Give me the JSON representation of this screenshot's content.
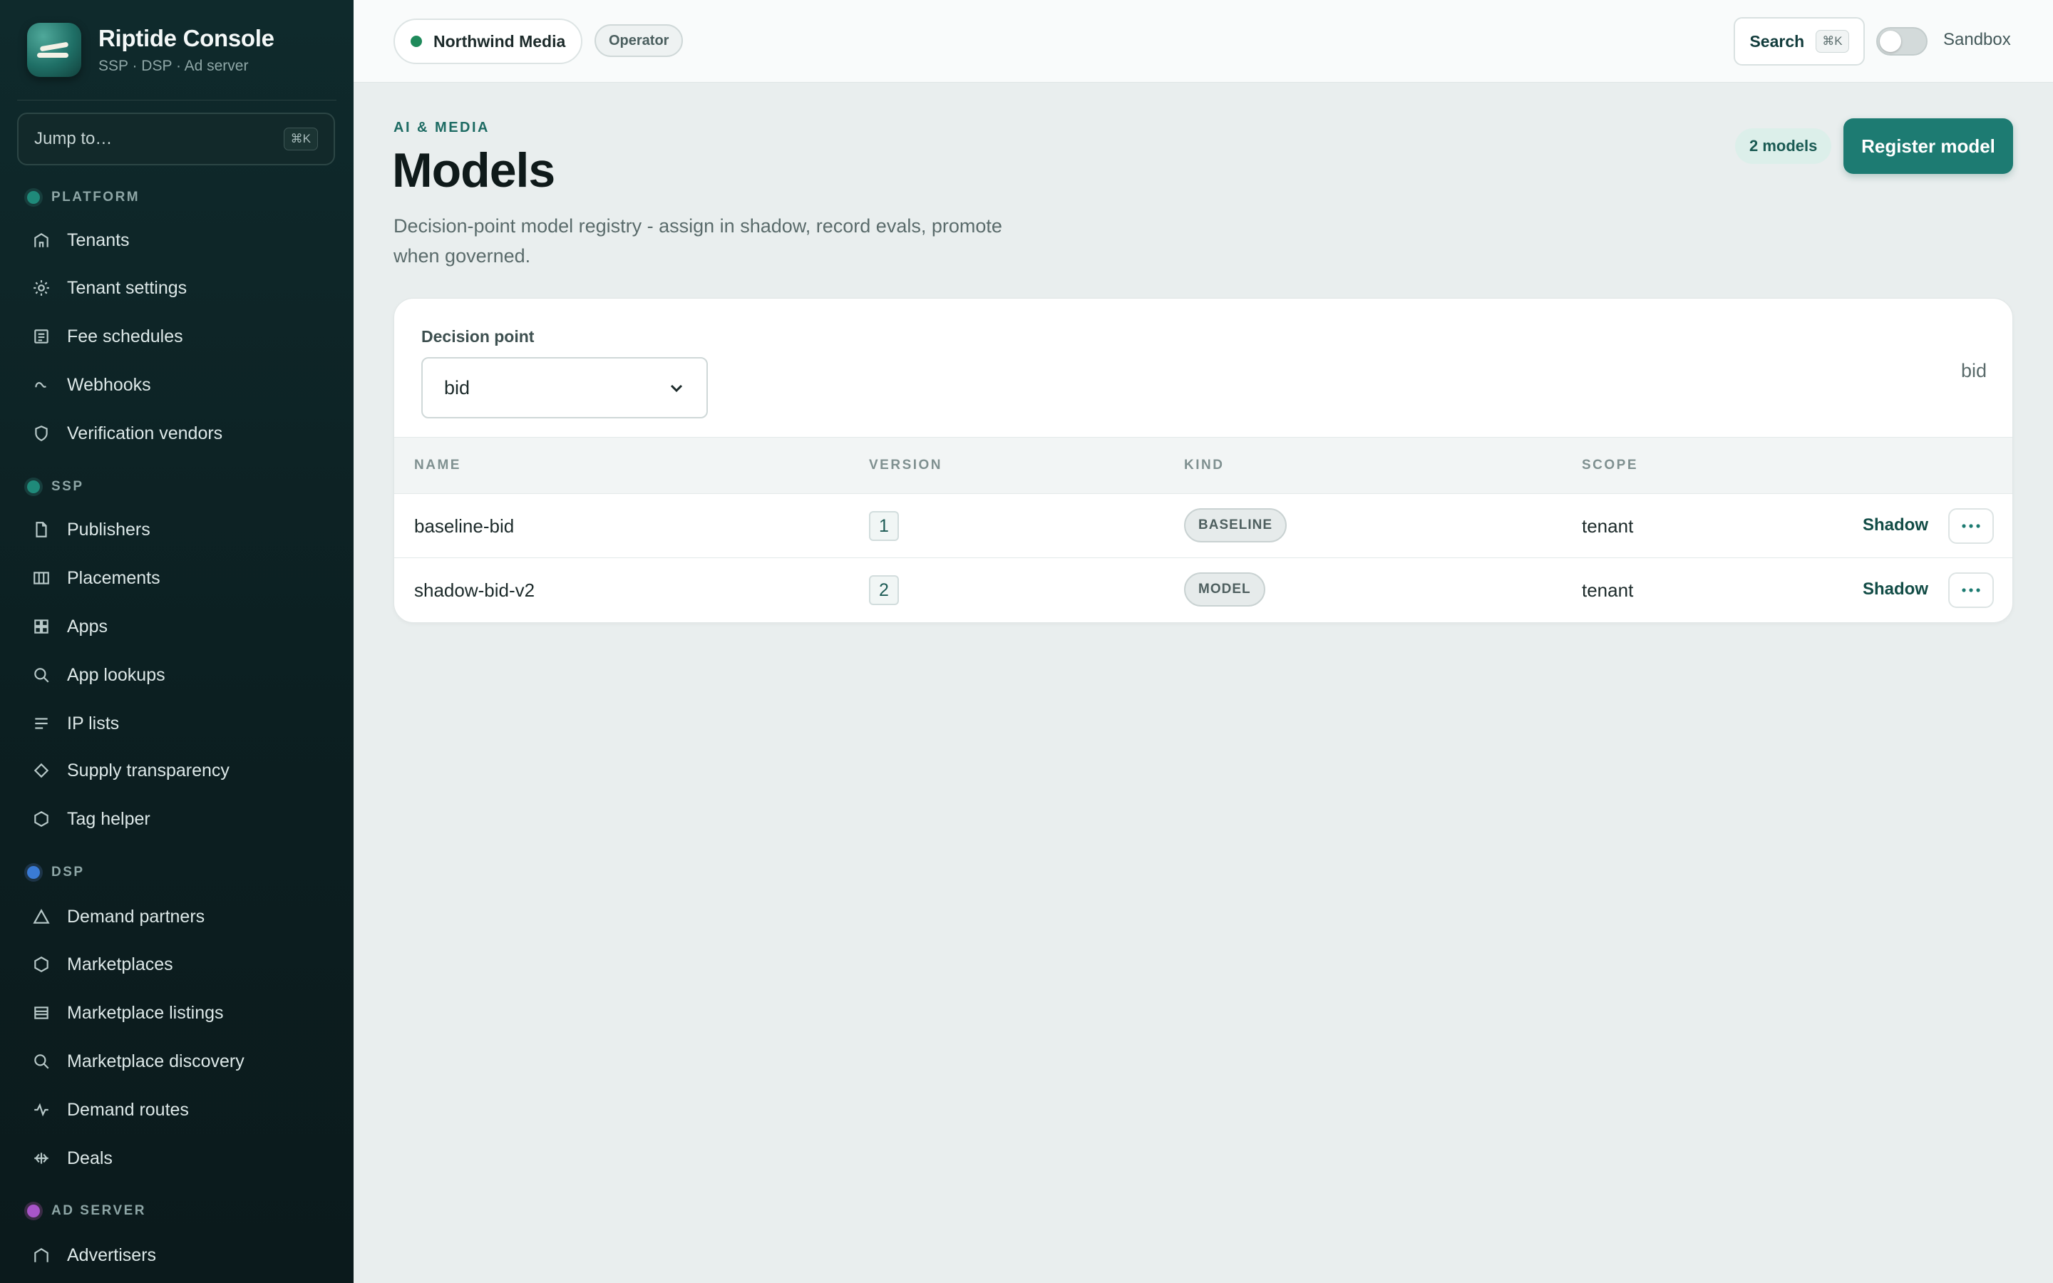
{
  "brand": {
    "title": "Riptide Console",
    "subtitle": "SSP · DSP · Ad server"
  },
  "jump": {
    "label": "Jump to…",
    "shortcut": "⌘K"
  },
  "sections": [
    {
      "label": "PLATFORM",
      "color": "#1f8a7a"
    },
    {
      "label": "SSP",
      "color": "#1f8a7a"
    },
    {
      "label": "DSP",
      "color": "#3a7bd5"
    },
    {
      "label": "AD SERVER",
      "color": "#a855c9"
    }
  ],
  "nav": {
    "platform": [
      {
        "label": "Tenants",
        "icon": "building-icon"
      },
      {
        "label": "Tenant settings",
        "icon": "gear-icon"
      },
      {
        "label": "Fee schedules",
        "icon": "receipt-icon"
      },
      {
        "label": "Webhooks",
        "icon": "webhook-icon"
      },
      {
        "label": "Verification vendors",
        "icon": "shield-icon"
      }
    ],
    "ssp": [
      {
        "label": "Publishers",
        "icon": "file-icon"
      },
      {
        "label": "Placements",
        "icon": "columns-icon"
      },
      {
        "label": "Apps",
        "icon": "grid-icon"
      },
      {
        "label": "App lookups",
        "icon": "search-icon"
      },
      {
        "label": "IP lists",
        "icon": "list-icon"
      },
      {
        "label": "Supply transparency",
        "icon": "diamond-icon"
      },
      {
        "label": "Tag helper",
        "icon": "hexagon-icon"
      }
    ],
    "dsp": [
      {
        "label": "Demand partners",
        "icon": "triangle-icon"
      },
      {
        "label": "Marketplaces",
        "icon": "hexagon-icon"
      },
      {
        "label": "Marketplace listings",
        "icon": "listing-icon"
      },
      {
        "label": "Marketplace discovery",
        "icon": "search-icon"
      },
      {
        "label": "Demand routes",
        "icon": "pulse-icon"
      },
      {
        "label": "Deals",
        "icon": "deals-icon"
      }
    ],
    "adserver": [
      {
        "label": "Advertisers",
        "icon": "building-icon"
      }
    ]
  },
  "topbar": {
    "tenant": "Northwind Media",
    "role": "Operator",
    "search_label": "Search",
    "search_shortcut": "⌘K",
    "sandbox_label": "Sandbox",
    "sandbox_on": false
  },
  "page": {
    "eyebrow": "AI & MEDIA",
    "title": "Models",
    "description": "Decision-point model registry - assign in shadow, record evals, promote when governed.",
    "count_badge": "2 models",
    "register_label": "Register model"
  },
  "filter": {
    "label": "Decision point",
    "value": "bid",
    "current": "bid"
  },
  "table": {
    "columns": [
      "NAME",
      "VERSION",
      "KIND",
      "SCOPE"
    ],
    "rows": [
      {
        "name": "baseline-bid",
        "version": "1",
        "kind": "BASELINE",
        "scope": "tenant",
        "action": "Shadow"
      },
      {
        "name": "shadow-bid-v2",
        "version": "2",
        "kind": "MODEL",
        "scope": "tenant",
        "action": "Shadow"
      }
    ]
  }
}
